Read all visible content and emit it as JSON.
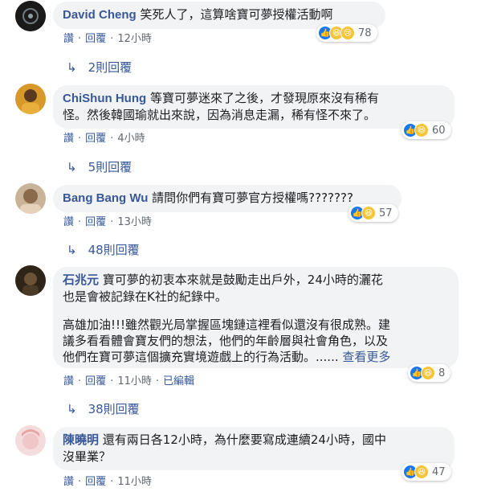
{
  "comments": [
    {
      "name": "David Cheng",
      "text": "笑死人了，這算啥寶可夢授權活動啊",
      "actions": {
        "like": "讚",
        "reply": "回覆",
        "time": "12小時"
      },
      "reaction_count": "78",
      "reactions": [
        "like-icon",
        "haha-icon",
        "sad-icon"
      ],
      "replies": "2則回覆",
      "avatar_color": "#1a1a1a"
    },
    {
      "name": "ChiShun Hung",
      "text_lines": [
        "等寶可夢迷來了之後，才發現原來沒有稀有",
        "怪。然後韓國瑜就出來說，因為消息走漏，稀有怪不來了。"
      ],
      "actions": {
        "like": "讚",
        "reply": "回覆",
        "time": "4小時"
      },
      "reaction_count": "60",
      "reactions": [
        "like-icon",
        "haha-icon"
      ],
      "replies": "5則回覆",
      "avatar_color": "#d79a2a"
    },
    {
      "name": "Bang Bang Wu",
      "text": "請問你們有寶可夢官方授權嗎???????",
      "actions": {
        "like": "讚",
        "reply": "回覆",
        "time": "13小時"
      },
      "reaction_count": "57",
      "reactions": [
        "like-icon",
        "haha-icon"
      ],
      "replies": "48則回覆",
      "avatar_color": "#b38b6d"
    },
    {
      "name": "石兆元",
      "text_lines": [
        "寶可夢的初衷本來就是鼓勵走出戶外，24小時的灑花",
        "也是會被記錄在K社的紀錄中。"
      ],
      "text2_lines": [
        "高雄加油!!!雖然觀光局掌握區塊鏈這裡看似還沒有很成熟。建",
        "議多看看體會寶友們的想法，他們的年齡層與社會角色，以及",
        "他們在寶可夢這個擴充實境遊戲上的行為活動。......"
      ],
      "see_more": "查看更多",
      "actions": {
        "like": "讚",
        "reply": "回覆",
        "time": "11小時",
        "edited": "已編輯"
      },
      "reaction_count": "8",
      "reactions": [
        "like-icon",
        "haha-icon"
      ],
      "replies": "38則回覆",
      "avatar_color": "#3a2a1a"
    },
    {
      "name": "陳曉明",
      "text_lines": [
        "還有兩日各12小時，為什麼要寫成連續24小時，國中",
        "沒畢業？"
      ],
      "actions": {
        "like": "讚",
        "reply": "回覆",
        "time": "11小時"
      },
      "reaction_count": "47",
      "reactions": [
        "like-icon",
        "haha-icon"
      ],
      "avatar_color": "#f0c6c6"
    }
  ],
  "reply_arrow": "↳"
}
